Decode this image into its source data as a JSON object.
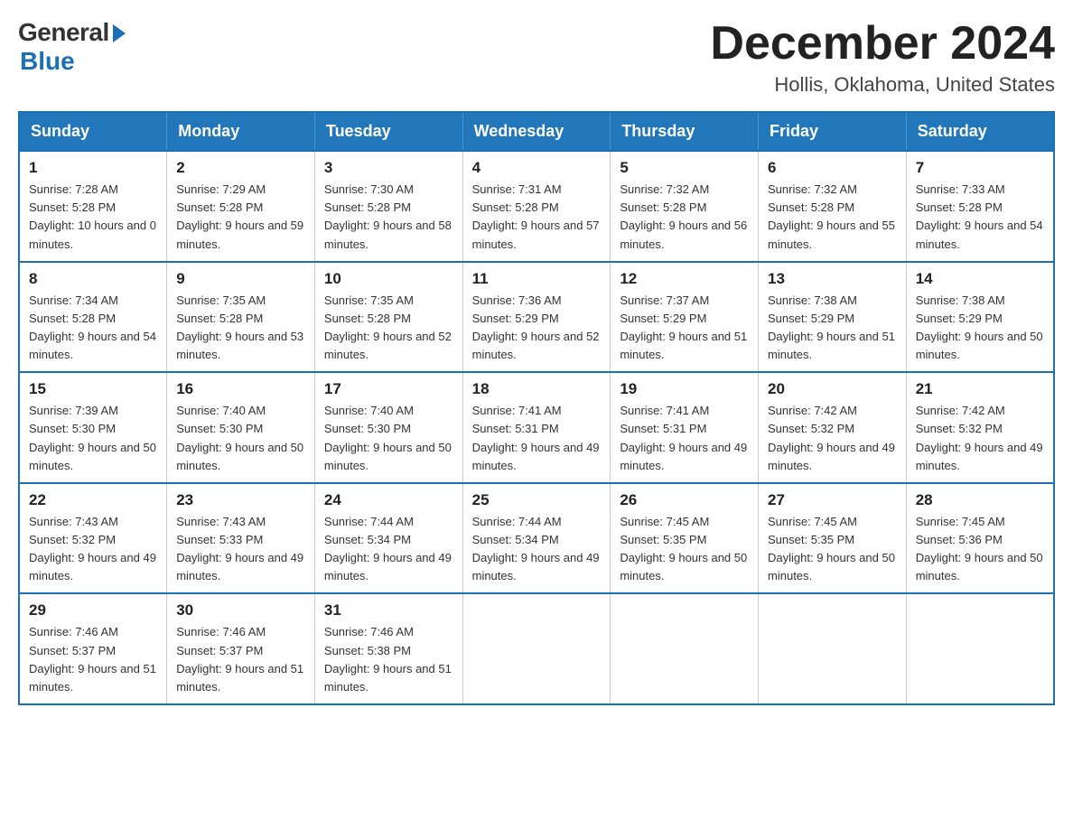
{
  "logo": {
    "general": "General",
    "blue": "Blue"
  },
  "title": {
    "month": "December 2024",
    "location": "Hollis, Oklahoma, United States"
  },
  "days_of_week": [
    "Sunday",
    "Monday",
    "Tuesday",
    "Wednesday",
    "Thursday",
    "Friday",
    "Saturday"
  ],
  "weeks": [
    [
      {
        "day": "1",
        "sunrise": "7:28 AM",
        "sunset": "5:28 PM",
        "daylight": "10 hours and 0 minutes."
      },
      {
        "day": "2",
        "sunrise": "7:29 AM",
        "sunset": "5:28 PM",
        "daylight": "9 hours and 59 minutes."
      },
      {
        "day": "3",
        "sunrise": "7:30 AM",
        "sunset": "5:28 PM",
        "daylight": "9 hours and 58 minutes."
      },
      {
        "day": "4",
        "sunrise": "7:31 AM",
        "sunset": "5:28 PM",
        "daylight": "9 hours and 57 minutes."
      },
      {
        "day": "5",
        "sunrise": "7:32 AM",
        "sunset": "5:28 PM",
        "daylight": "9 hours and 56 minutes."
      },
      {
        "day": "6",
        "sunrise": "7:32 AM",
        "sunset": "5:28 PM",
        "daylight": "9 hours and 55 minutes."
      },
      {
        "day": "7",
        "sunrise": "7:33 AM",
        "sunset": "5:28 PM",
        "daylight": "9 hours and 54 minutes."
      }
    ],
    [
      {
        "day": "8",
        "sunrise": "7:34 AM",
        "sunset": "5:28 PM",
        "daylight": "9 hours and 54 minutes."
      },
      {
        "day": "9",
        "sunrise": "7:35 AM",
        "sunset": "5:28 PM",
        "daylight": "9 hours and 53 minutes."
      },
      {
        "day": "10",
        "sunrise": "7:35 AM",
        "sunset": "5:28 PM",
        "daylight": "9 hours and 52 minutes."
      },
      {
        "day": "11",
        "sunrise": "7:36 AM",
        "sunset": "5:29 PM",
        "daylight": "9 hours and 52 minutes."
      },
      {
        "day": "12",
        "sunrise": "7:37 AM",
        "sunset": "5:29 PM",
        "daylight": "9 hours and 51 minutes."
      },
      {
        "day": "13",
        "sunrise": "7:38 AM",
        "sunset": "5:29 PM",
        "daylight": "9 hours and 51 minutes."
      },
      {
        "day": "14",
        "sunrise": "7:38 AM",
        "sunset": "5:29 PM",
        "daylight": "9 hours and 50 minutes."
      }
    ],
    [
      {
        "day": "15",
        "sunrise": "7:39 AM",
        "sunset": "5:30 PM",
        "daylight": "9 hours and 50 minutes."
      },
      {
        "day": "16",
        "sunrise": "7:40 AM",
        "sunset": "5:30 PM",
        "daylight": "9 hours and 50 minutes."
      },
      {
        "day": "17",
        "sunrise": "7:40 AM",
        "sunset": "5:30 PM",
        "daylight": "9 hours and 50 minutes."
      },
      {
        "day": "18",
        "sunrise": "7:41 AM",
        "sunset": "5:31 PM",
        "daylight": "9 hours and 49 minutes."
      },
      {
        "day": "19",
        "sunrise": "7:41 AM",
        "sunset": "5:31 PM",
        "daylight": "9 hours and 49 minutes."
      },
      {
        "day": "20",
        "sunrise": "7:42 AM",
        "sunset": "5:32 PM",
        "daylight": "9 hours and 49 minutes."
      },
      {
        "day": "21",
        "sunrise": "7:42 AM",
        "sunset": "5:32 PM",
        "daylight": "9 hours and 49 minutes."
      }
    ],
    [
      {
        "day": "22",
        "sunrise": "7:43 AM",
        "sunset": "5:32 PM",
        "daylight": "9 hours and 49 minutes."
      },
      {
        "day": "23",
        "sunrise": "7:43 AM",
        "sunset": "5:33 PM",
        "daylight": "9 hours and 49 minutes."
      },
      {
        "day": "24",
        "sunrise": "7:44 AM",
        "sunset": "5:34 PM",
        "daylight": "9 hours and 49 minutes."
      },
      {
        "day": "25",
        "sunrise": "7:44 AM",
        "sunset": "5:34 PM",
        "daylight": "9 hours and 49 minutes."
      },
      {
        "day": "26",
        "sunrise": "7:45 AM",
        "sunset": "5:35 PM",
        "daylight": "9 hours and 50 minutes."
      },
      {
        "day": "27",
        "sunrise": "7:45 AM",
        "sunset": "5:35 PM",
        "daylight": "9 hours and 50 minutes."
      },
      {
        "day": "28",
        "sunrise": "7:45 AM",
        "sunset": "5:36 PM",
        "daylight": "9 hours and 50 minutes."
      }
    ],
    [
      {
        "day": "29",
        "sunrise": "7:46 AM",
        "sunset": "5:37 PM",
        "daylight": "9 hours and 51 minutes."
      },
      {
        "day": "30",
        "sunrise": "7:46 AM",
        "sunset": "5:37 PM",
        "daylight": "9 hours and 51 minutes."
      },
      {
        "day": "31",
        "sunrise": "7:46 AM",
        "sunset": "5:38 PM",
        "daylight": "9 hours and 51 minutes."
      },
      null,
      null,
      null,
      null
    ]
  ],
  "colors": {
    "header_bg": "#2277bb",
    "border": "#1a6fb5"
  }
}
